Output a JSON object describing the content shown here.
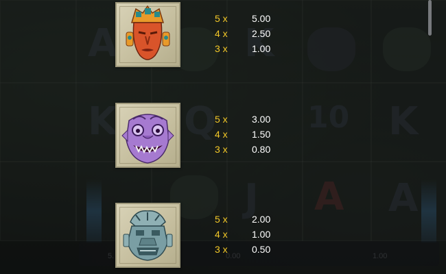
{
  "colors": {
    "multiplier_text": "#f4c928",
    "payout_text": "#ffffff",
    "tile_background": "#d2cbb0"
  },
  "paytable": [
    {
      "symbol_icon": "orange-tribal-mask-icon",
      "payouts": [
        {
          "multiplier": "5 x",
          "value": "5.00"
        },
        {
          "multiplier": "4 x",
          "value": "2.50"
        },
        {
          "multiplier": "3 x",
          "value": "1.00"
        }
      ]
    },
    {
      "symbol_icon": "purple-demon-mask-icon",
      "payouts": [
        {
          "multiplier": "5 x",
          "value": "3.00"
        },
        {
          "multiplier": "4 x",
          "value": "1.50"
        },
        {
          "multiplier": "3 x",
          "value": "0.80"
        }
      ]
    },
    {
      "symbol_icon": "teal-stone-mask-icon",
      "payouts": [
        {
          "multiplier": "5 x",
          "value": "2.00"
        },
        {
          "multiplier": "4 x",
          "value": "1.00"
        },
        {
          "multiplier": "3 x",
          "value": "0.50"
        }
      ]
    }
  ],
  "background_bar": {
    "balance_fragment": "5.",
    "win_fragment": "0.00",
    "bet_fragment": "1.00"
  }
}
